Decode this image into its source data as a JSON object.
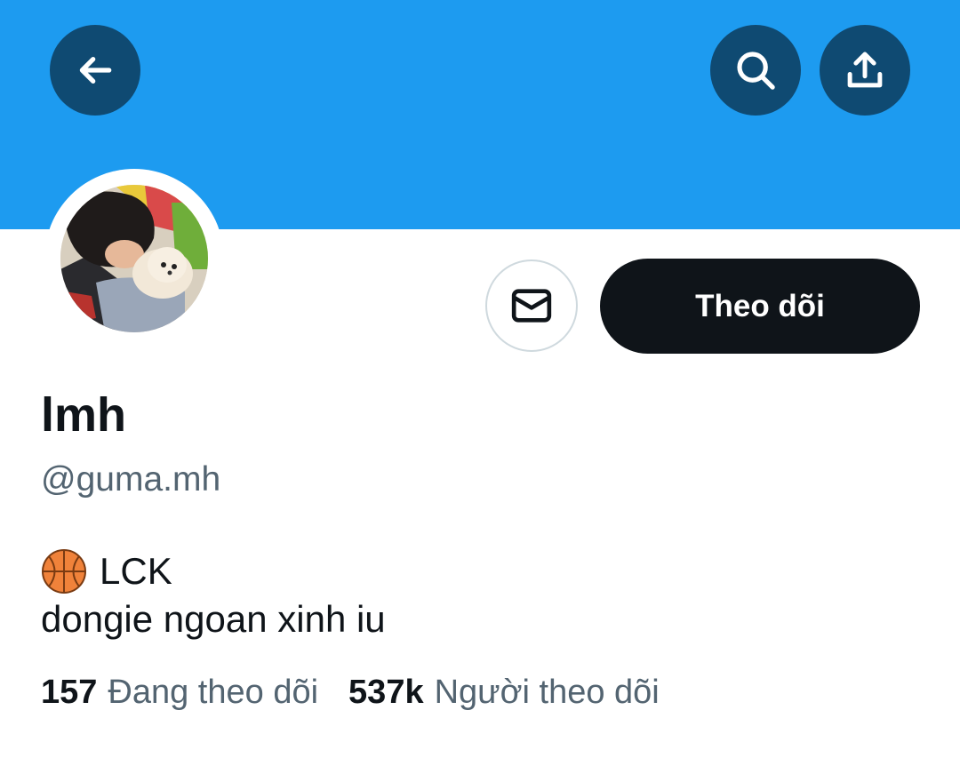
{
  "header": {
    "banner_color": "#1d9bf0",
    "back_icon": "arrow-left-icon",
    "search_icon": "search-icon",
    "share_icon": "share-upload-icon"
  },
  "profile": {
    "display_name": "lmh",
    "handle": "@guma.mh",
    "avatar_icon": "profile-photo",
    "bio": {
      "emoji_icon": "basketball-icon",
      "line1": "LCK",
      "line2": "dongie ngoan xinh iu"
    }
  },
  "actions": {
    "message_icon": "envelope-icon",
    "follow_label": "Theo dõi"
  },
  "stats": {
    "following_count": "157",
    "following_label": "Đang theo dõi",
    "followers_count": "537k",
    "followers_label": "Người theo dõi"
  }
}
